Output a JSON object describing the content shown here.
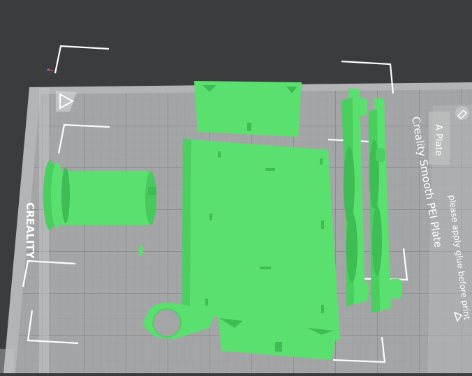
{
  "plate": {
    "brand_label": "CREALITY",
    "plate_type_label": "Creality Smooth PEI Plate",
    "plate_name_label": "A Plate",
    "notice_label": "please apply glue before print",
    "edit_icon": "edit-icon",
    "warning_icon": "warning-triangle-icon"
  },
  "colors": {
    "background": "#3b3c3e",
    "bed": "#a9aaab",
    "grid": "#8d8e8f",
    "model": "#5ae06e",
    "model_shade": "#3fbd55",
    "bracket": "#ffffff"
  }
}
